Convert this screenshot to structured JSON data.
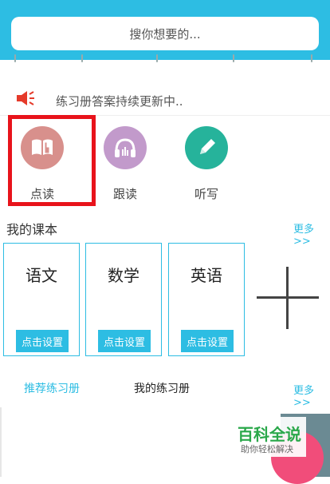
{
  "search": {
    "placeholder": "搜你想要的..."
  },
  "notice": {
    "text": "练习册答案持续更新中.."
  },
  "functions": [
    {
      "label": "点读",
      "icon": "book-hand-icon",
      "color": "#d8908c"
    },
    {
      "label": "跟读",
      "icon": "headphones-icon",
      "color": "#c29acb"
    },
    {
      "label": "听写",
      "icon": "pencil-icon",
      "color": "#26b39b"
    }
  ],
  "my_textbooks": {
    "title": "我的课本",
    "more": "更多>>",
    "books": [
      {
        "name": "语文",
        "button": "点击设置"
      },
      {
        "name": "数学",
        "button": "点击设置"
      },
      {
        "name": "英语",
        "button": "点击设置"
      }
    ]
  },
  "tabs": {
    "recommended": "推荐练习册",
    "mine": "我的练习册",
    "more": "更多>>"
  },
  "watermark": {
    "title": "百科全说",
    "subtitle": "助你轻松解决"
  },
  "colors": {
    "accent": "#2dbde3",
    "highlight": "#e8131b",
    "fab": "#f14d7a"
  }
}
